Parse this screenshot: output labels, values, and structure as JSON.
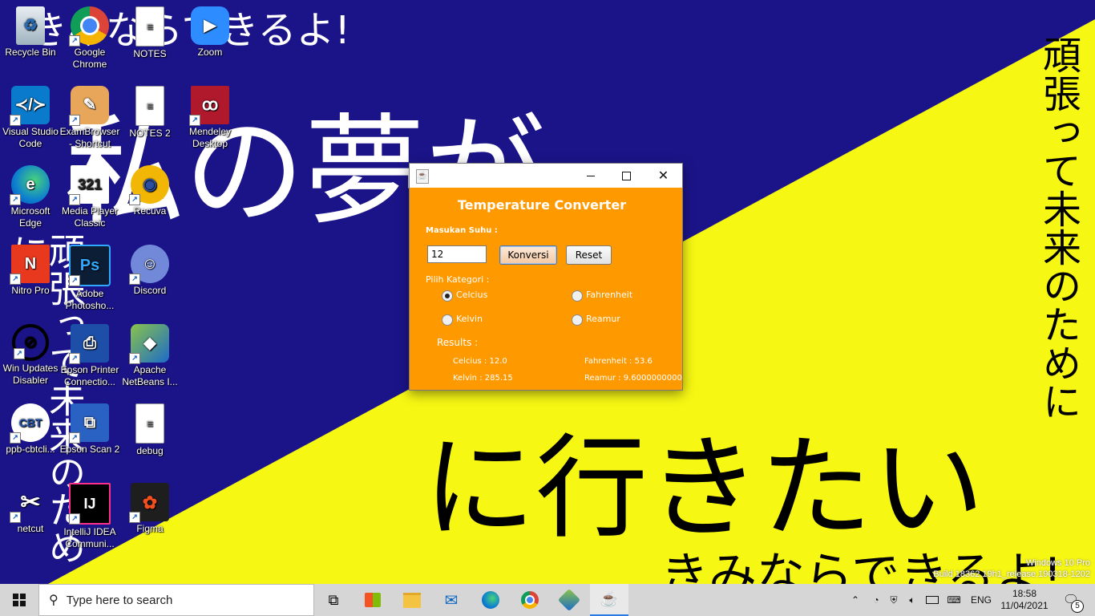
{
  "wallpaper": {
    "top_line": "きみならできるよ!",
    "big_blue_line": "私の夢が",
    "big_yellow_line": "に行きたい",
    "bottom_line": "きみならできるよ!",
    "vertical_right": "頑張って未来のために",
    "vertical_left": "頑張って未来のために",
    "colors": {
      "blue": "#1b1489",
      "yellow": "#f7f714"
    }
  },
  "watermark": {
    "line1": "Windows 10 Pro",
    "line2": "Build 18362.19h1_release.190318-1202"
  },
  "desktop_icons": [
    {
      "label": "Recycle Bin",
      "icon": "recycle-bin-icon"
    },
    {
      "label": "Google Chrome",
      "icon": "chrome-icon"
    },
    {
      "label": "NOTES",
      "icon": "text-file-icon"
    },
    {
      "label": "Zoom",
      "icon": "zoom-icon"
    },
    {
      "label": "Visual Studio Code",
      "icon": "vscode-icon"
    },
    {
      "label": "ExamBrowser - Shortcut",
      "icon": "exambrowser-icon"
    },
    {
      "label": "NOTES 2",
      "icon": "text-file-icon"
    },
    {
      "label": "Mendeley Desktop",
      "icon": "mendeley-icon"
    },
    {
      "label": "Microsoft Edge",
      "icon": "edge-icon"
    },
    {
      "label": "Media Player Classic",
      "icon": "media-player-icon"
    },
    {
      "label": "Recuva",
      "icon": "recuva-icon"
    },
    {
      "label": "Nitro Pro",
      "icon": "nitro-pro-icon"
    },
    {
      "label": "Adobe Photosho...",
      "icon": "photoshop-icon"
    },
    {
      "label": "Discord",
      "icon": "discord-icon"
    },
    {
      "label": "Win Updates Disabler",
      "icon": "win-updates-disabler-icon"
    },
    {
      "label": "Epson Printer Connectio...",
      "icon": "epson-printer-icon"
    },
    {
      "label": "Apache NetBeans I...",
      "icon": "netbeans-icon"
    },
    {
      "label": "ppb-cbtcli...",
      "icon": "ppb-cbt-icon"
    },
    {
      "label": "Epson Scan 2",
      "icon": "epson-scan-icon"
    },
    {
      "label": "debug",
      "icon": "text-file-icon"
    },
    {
      "label": "netcut",
      "icon": "netcut-icon"
    },
    {
      "label": "IntelliJ IDEA Communi...",
      "icon": "intellij-icon"
    },
    {
      "label": "Figma",
      "icon": "figma-icon"
    }
  ],
  "converter": {
    "title": "Temperature Converter",
    "input_label": "Masukan Suhu :",
    "input_value": "12",
    "convert_button": "Konversi",
    "reset_button": "Reset",
    "category_label": "Pilih Kategori :",
    "radios": {
      "celcius": "Celcius",
      "fahrenheit": "Fahrenheit",
      "kelvin": "Kelvin",
      "reamur": "Reamur"
    },
    "selected": "Celcius",
    "results_label": "Results :",
    "results": {
      "celcius": "Celcius  : 12.0",
      "fahrenheit": "Fahrenheit  : 53.6",
      "kelvin": "Kelvin  : 285.15",
      "reamur": "Reamur  : 9.6000000000"
    },
    "colors": {
      "panel": "#ff9900"
    }
  },
  "taskbar": {
    "search_placeholder": "Type here to search",
    "apps": [
      "task-view-icon",
      "microsoft-store-icon",
      "file-explorer-icon",
      "mail-icon",
      "edge-icon",
      "chrome-icon",
      "netbeans-icon",
      "java-icon"
    ],
    "language": "ENG",
    "time": "18:58",
    "date": "11/04/2021",
    "notification_count": "5"
  }
}
